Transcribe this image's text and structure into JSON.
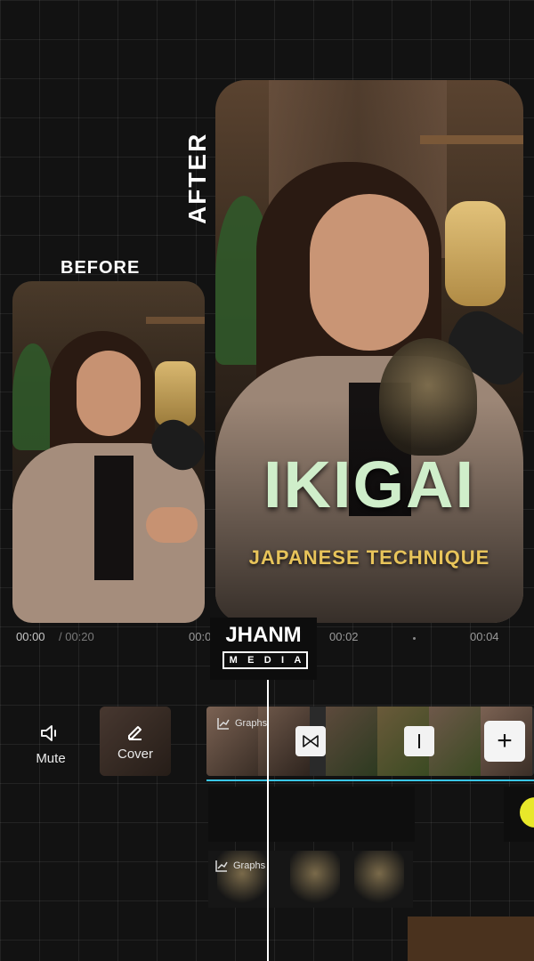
{
  "labels": {
    "before": "BEFORE",
    "after": "AFTER"
  },
  "thumbnail": {
    "headline": "IKIGAI",
    "subheadline": "JAPANESE TECHNIQUE"
  },
  "timeline": {
    "current_time": "00:00",
    "total_time": " / 00:20",
    "ticks": [
      "00:0",
      "00:02",
      "00:04"
    ],
    "tracks": [
      {
        "label": "Graphs"
      },
      {
        "label": "Graphs"
      }
    ]
  },
  "toolbar": {
    "mute_label": "Mute",
    "cover_label": "Cover",
    "add_label": "+"
  },
  "logo": {
    "main": "JHANM",
    "sub": [
      "M",
      "E",
      "D",
      "I",
      "A"
    ]
  },
  "colors": {
    "accent_line": "#39c6e6",
    "headline": "#cfeeca",
    "subheadline": "#e8c45a",
    "keyframe": "#e8e82a"
  },
  "icons": [
    "speaker-icon",
    "edit-pencil-icon",
    "graph-icon",
    "transition-icon",
    "split-icon",
    "plus-icon"
  ]
}
